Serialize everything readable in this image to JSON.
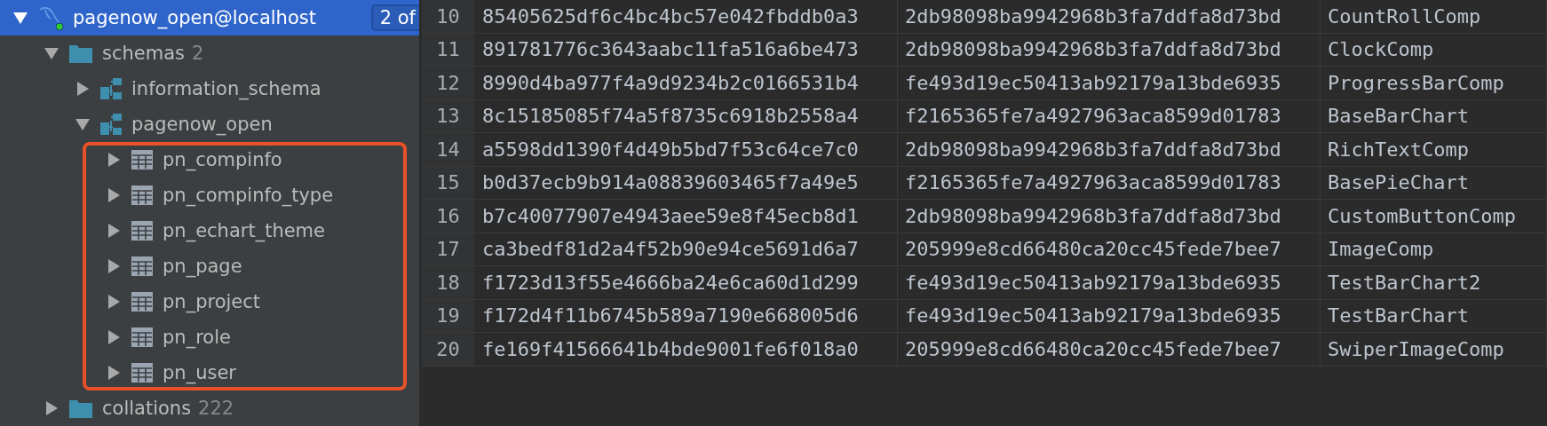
{
  "tree": [
    {
      "label": "pagenow_open@localhost",
      "kind": "datasource",
      "expanded": true,
      "selected": true,
      "connected": true,
      "badge": "2 of",
      "children": [
        {
          "label": "schemas",
          "count": "2",
          "kind": "folder",
          "expanded": true,
          "selected": false,
          "children": [
            {
              "label": "information_schema",
              "kind": "schema",
              "expanded": false,
              "selected": false
            },
            {
              "label": "pagenow_open",
              "kind": "schema",
              "expanded": true,
              "selected": false,
              "highlighted": true,
              "children": [
                {
                  "label": "pn_compinfo",
                  "kind": "table",
                  "expanded": false,
                  "selected": false
                },
                {
                  "label": "pn_compinfo_type",
                  "kind": "table",
                  "expanded": false,
                  "selected": false
                },
                {
                  "label": "pn_echart_theme",
                  "kind": "table",
                  "expanded": false,
                  "selected": false
                },
                {
                  "label": "pn_page",
                  "kind": "table",
                  "expanded": false,
                  "selected": false
                },
                {
                  "label": "pn_project",
                  "kind": "table",
                  "expanded": false,
                  "selected": false
                },
                {
                  "label": "pn_role",
                  "kind": "table",
                  "expanded": false,
                  "selected": false
                },
                {
                  "label": "pn_user",
                  "kind": "table",
                  "expanded": false,
                  "selected": false
                }
              ]
            }
          ]
        },
        {
          "label": "collations",
          "count": "222",
          "kind": "folder",
          "expanded": false,
          "selected": false
        }
      ]
    }
  ],
  "grid": {
    "rows": [
      {
        "number": "10",
        "cells": [
          "85405625df6c4bc4bc57e042fbddb0a3",
          "2db98098ba9942968b3fa7ddfa8d73bd",
          "CountRollComp"
        ]
      },
      {
        "number": "11",
        "cells": [
          "891781776c3643aabc11fa516a6be473",
          "2db98098ba9942968b3fa7ddfa8d73bd",
          "ClockComp"
        ]
      },
      {
        "number": "12",
        "cells": [
          "8990d4ba977f4a9d9234b2c0166531b4",
          "fe493d19ec50413ab92179a13bde6935",
          "ProgressBarComp"
        ]
      },
      {
        "number": "13",
        "cells": [
          "8c15185085f74a5f8735c6918b2558a4",
          "f2165365fe7a4927963aca8599d01783",
          "BaseBarChart"
        ]
      },
      {
        "number": "14",
        "cells": [
          "a5598dd1390f4d49b5bd7f53c64ce7c0",
          "2db98098ba9942968b3fa7ddfa8d73bd",
          "RichTextComp"
        ]
      },
      {
        "number": "15",
        "cells": [
          "b0d37ecb9b914a08839603465f7a49e5",
          "f2165365fe7a4927963aca8599d01783",
          "BasePieChart"
        ]
      },
      {
        "number": "16",
        "cells": [
          "b7c40077907e4943aee59e8f45ecb8d1",
          "2db98098ba9942968b3fa7ddfa8d73bd",
          "CustomButtonComp"
        ]
      },
      {
        "number": "17",
        "cells": [
          "ca3bedf81d2a4f52b90e94ce5691d6a7",
          "205999e8cd66480ca20cc45fede7bee7",
          "ImageComp"
        ]
      },
      {
        "number": "18",
        "cells": [
          "f1723d13f55e4666ba24e6ca60d1d299",
          "fe493d19ec50413ab92179a13bde6935",
          "TestBarChart2"
        ]
      },
      {
        "number": "19",
        "cells": [
          "f172d4f11b6745b589a7190e668005d6",
          "fe493d19ec50413ab92179a13bde6935",
          "TestBarChart"
        ]
      },
      {
        "number": "20",
        "cells": [
          "fe169f41566641b4bde9001fe6f018a0",
          "205999e8cd66480ca20cc45fede7bee7",
          "SwiperImageComp"
        ]
      }
    ]
  }
}
